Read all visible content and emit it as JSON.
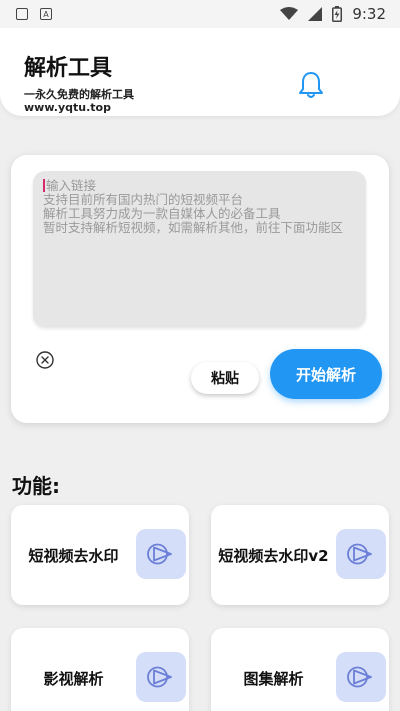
{
  "status_bar": {
    "time": "9:32",
    "icons": [
      "image-notification-icon",
      "a-notification-icon",
      "wifi-icon",
      "signal-icon",
      "battery-icon"
    ]
  },
  "header": {
    "title": "解析工具",
    "subtitle": "一永久免费的解析工具",
    "url": "www.yqtu.top",
    "bell_icon": "bell-icon"
  },
  "input": {
    "placeholder_lines": [
      "输入链接",
      "支持目前所有国内热门的短视频平台",
      "解析工具努力成为一款自媒体人的必备工具",
      "暂时支持解析短视频，如需解析其他，前往下面功能区"
    ],
    "paste_label": "粘贴",
    "start_label": "开始解析",
    "clear_icon": "clear-icon"
  },
  "features": {
    "heading": "功能:",
    "items": [
      {
        "label": "短视频去水印",
        "icon": "play-icon"
      },
      {
        "label": "短视频去水印v2",
        "icon": "play-icon"
      },
      {
        "label": "影视解析",
        "icon": "play-icon"
      },
      {
        "label": "图集解析",
        "icon": "play-icon"
      }
    ]
  },
  "colors": {
    "primary": "#2196f3",
    "icon_tile": "#d4def9",
    "icon_stroke": "#6b7fd7",
    "background": "#efefef"
  }
}
